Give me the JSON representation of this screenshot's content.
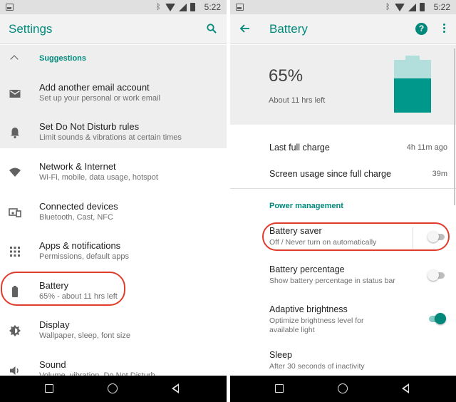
{
  "colors": {
    "accent": "#00897b",
    "highlight_ring": "#e03c2c",
    "battery_fill": "#00988a",
    "battery_empty": "#b2dfdb"
  },
  "left": {
    "status_bar": {
      "time": "5:22"
    },
    "app_bar": {
      "title": "Settings",
      "search_icon": "search-icon"
    },
    "suggestions": {
      "header": "Suggestions",
      "items": [
        {
          "title": "Add another email account",
          "subtitle": "Set up your personal or work email",
          "icon": "email-icon"
        },
        {
          "title": "Set Do Not Disturb rules",
          "subtitle": "Limit sounds & vibrations at certain times",
          "icon": "bell-icon"
        }
      ]
    },
    "items": [
      {
        "title": "Network & Internet",
        "subtitle": "Wi-Fi, mobile, data usage, hotspot",
        "icon": "wifi-icon"
      },
      {
        "title": "Connected devices",
        "subtitle": "Bluetooth, Cast, NFC",
        "icon": "devices-icon"
      },
      {
        "title": "Apps & notifications",
        "subtitle": "Permissions, default apps",
        "icon": "apps-grid-icon"
      },
      {
        "title": "Battery",
        "subtitle": "65% - about 11 hrs left",
        "icon": "battery-icon"
      },
      {
        "title": "Display",
        "subtitle": "Wallpaper, sleep, font size",
        "icon": "brightness-icon"
      },
      {
        "title": "Sound",
        "subtitle": "Volume, vibration, Do Not Disturb",
        "icon": "volume-icon"
      }
    ]
  },
  "right": {
    "status_bar": {
      "time": "5:22"
    },
    "app_bar": {
      "title": "Battery",
      "help_label": "?"
    },
    "header": {
      "percent": "65%",
      "estimate": "About 11 hrs left",
      "level": 0.65
    },
    "info": [
      {
        "label": "Last full charge",
        "value": "4h 11m ago"
      },
      {
        "label": "Screen usage since full charge",
        "value": "39m"
      }
    ],
    "section": "Power management",
    "prefs": [
      {
        "title": "Battery saver",
        "subtitle": "Off / Never turn on automatically",
        "on": false
      },
      {
        "title": "Battery percentage",
        "subtitle": "Show battery percentage in status bar",
        "on": false
      },
      {
        "title": "Adaptive brightness",
        "subtitle": "Optimize brightness level for available light",
        "on": true
      },
      {
        "title": "Sleep",
        "subtitle": "After 30 seconds of inactivity"
      }
    ]
  }
}
